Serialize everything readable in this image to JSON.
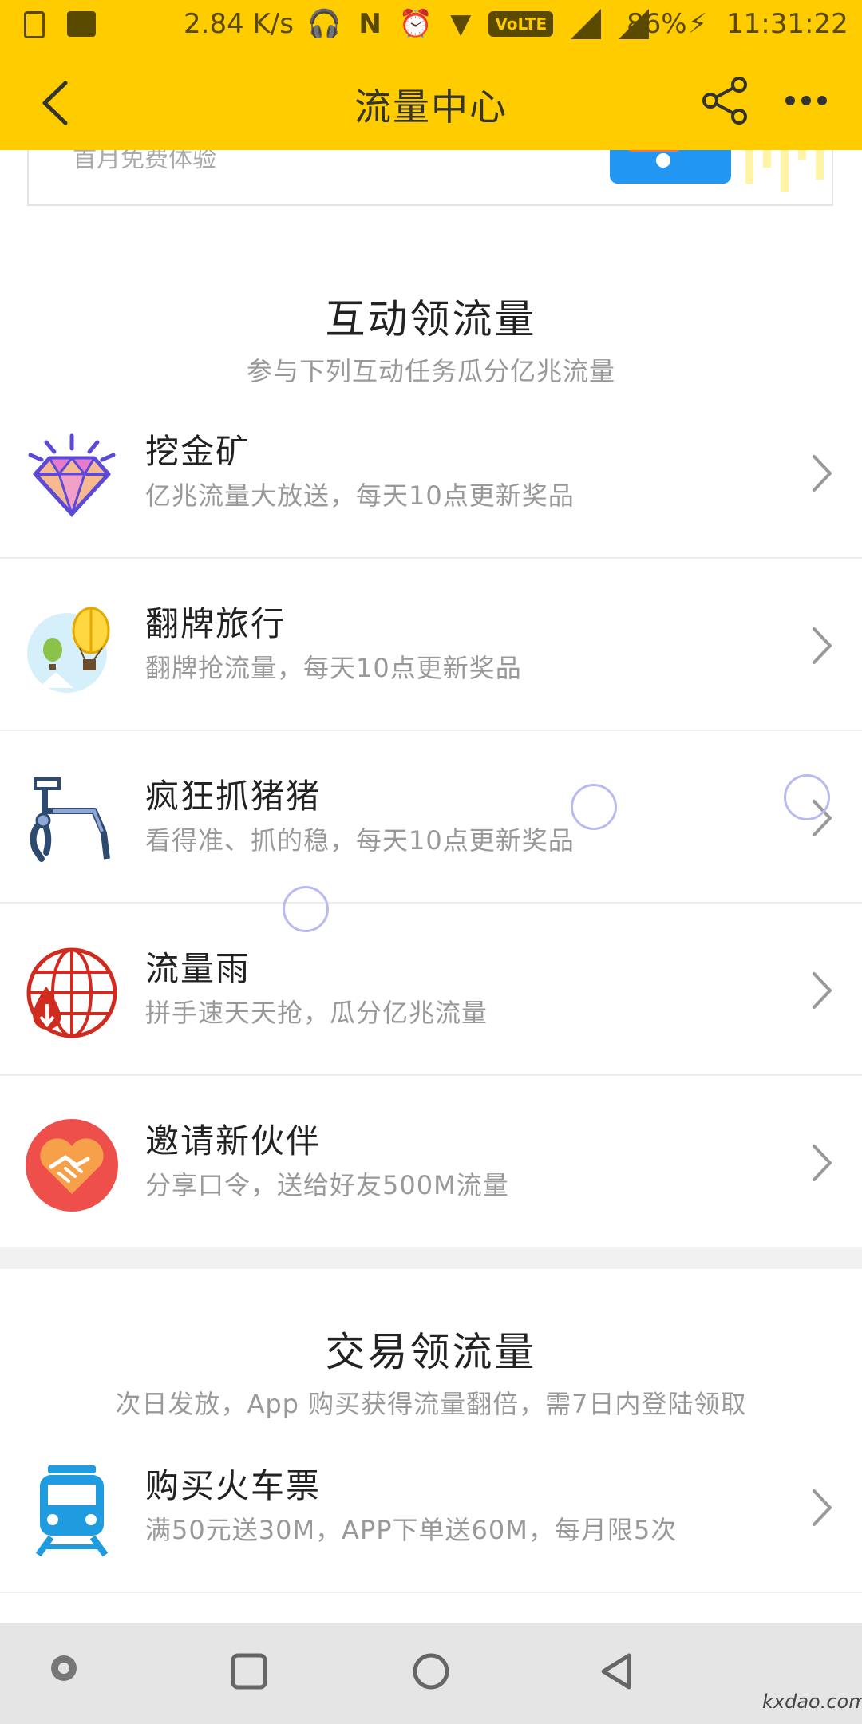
{
  "status_bar": {
    "network_speed": "2.84 K/s",
    "volte_label": "VoLTE",
    "battery": "86%",
    "time": "11:31:22"
  },
  "header": {
    "title": "流量中心"
  },
  "banner": {
    "text": "首月免费体验"
  },
  "interactive_section": {
    "title": "互动领流量",
    "subtitle": "参与下列互动任务瓜分亿兆流量",
    "items": [
      {
        "name": "挖金矿",
        "desc": "亿兆流量大放送，每天10点更新奖品",
        "icon": "diamond-icon"
      },
      {
        "name": "翻牌旅行",
        "desc": "翻牌抢流量，每天10点更新奖品",
        "icon": "hot-air-balloon-icon"
      },
      {
        "name": "疯狂抓猪猪",
        "desc": "看得准、抓的稳，每天10点更新奖品",
        "icon": "claw-machine-icon"
      },
      {
        "name": "流量雨",
        "desc": "拼手速天天抢，瓜分亿兆流量",
        "icon": "globe-download-icon"
      },
      {
        "name": "邀请新伙伴",
        "desc": "分享口令，送给好友500M流量",
        "icon": "handshake-heart-icon"
      }
    ]
  },
  "trade_section": {
    "title": "交易领流量",
    "subtitle": "次日发放，App 购买获得流量翻倍，需7日内登陆领取",
    "items": [
      {
        "name": "购买火车票",
        "desc": "满50元送30M，APP下单送60M，每月限5次",
        "icon": "train-icon"
      }
    ]
  },
  "watermark": "kxdao.com",
  "colors": {
    "accent": "#ffcc00",
    "title_text": "#333333",
    "sub_text": "#999999",
    "divider": "#eeeeee",
    "nav_bar": "#e5e5e5"
  }
}
